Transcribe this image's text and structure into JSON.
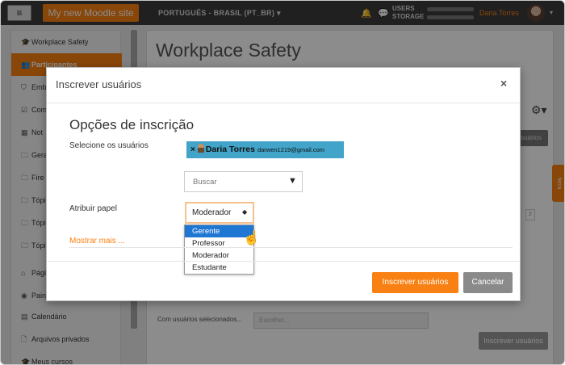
{
  "navbar": {
    "menu_icon": "hamburger-icon",
    "site_name": "My new Moodle site",
    "language": "PORTUGUÊS - BRASIL (PT_BR) ▾",
    "storage_line1": "USERS",
    "storage_line2": "STORAGE",
    "user_name": "Daria Torres",
    "user_caret": "▾"
  },
  "sidebar": {
    "items": [
      {
        "icon": "graduation-cap-icon",
        "label": "Workplace Safety"
      },
      {
        "icon": "users-icon",
        "label": "Participantes",
        "active": true
      },
      {
        "icon": "shield-icon",
        "label": "Emb"
      },
      {
        "icon": "check-square-icon",
        "label": "Com"
      },
      {
        "icon": "table-icon",
        "label": "Not"
      },
      {
        "icon": "folder-icon",
        "label": "Gera"
      },
      {
        "icon": "folder-icon",
        "label": "Fire"
      },
      {
        "icon": "folder-icon",
        "label": "Tópi"
      },
      {
        "icon": "folder-icon",
        "label": "Tópi"
      },
      {
        "icon": "folder-icon",
        "label": "Tópi"
      },
      {
        "icon": "home-icon",
        "label": "Pági"
      },
      {
        "icon": "dashboard-icon",
        "label": "Pain"
      },
      {
        "icon": "calendar-icon",
        "label": "Calendário"
      },
      {
        "icon": "file-icon",
        "label": "Arquivos privados"
      },
      {
        "icon": "graduation-cap-icon",
        "label": "Meus cursos"
      }
    ]
  },
  "page": {
    "course_title": "Workplace Safety",
    "bg_button_right": "suários",
    "bg_pager": "2",
    "selected_users_label": "Com usuários selecionados...",
    "selected_users_placeholder": "Escolher...",
    "bg_enroll_button": "Inscrever usuários",
    "lateral_tab": "ferra"
  },
  "modal": {
    "title": "Inscrever usuários",
    "close": "×",
    "section_title": "Opções de inscrição",
    "select_users_label": "Selecione os usuários",
    "chip": {
      "remove": "×",
      "name": "Daria Torres",
      "email": "darwen1219@gmail.com"
    },
    "search_placeholder": "Buscar",
    "role_label": "Atribuir papel",
    "role_value": "Moderador",
    "role_options": [
      "Gerente",
      "Professor",
      "Moderador",
      "Estudante"
    ],
    "role_highlighted": "Gerente",
    "show_more": "Mostrar mais ...",
    "enroll_button": "Inscrever usuários",
    "cancel_button": "Cancelar"
  },
  "colors": {
    "brand": "#f98012",
    "chip": "#41a4c8",
    "navbar": "#3b3b3b",
    "option_highlight": "#1e77d3"
  }
}
